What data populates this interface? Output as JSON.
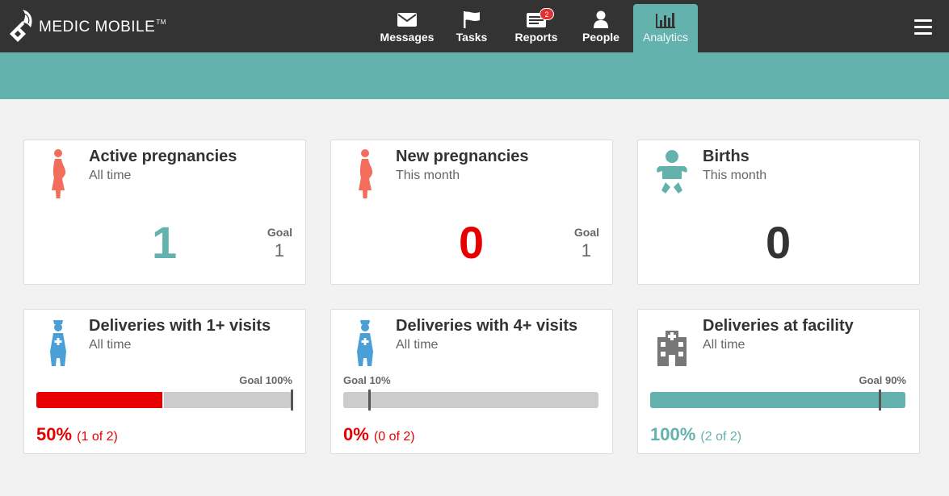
{
  "app": {
    "brand": "MEDIC MOBILE",
    "trademark": "TM"
  },
  "nav": {
    "tabs": [
      {
        "label": "Messages",
        "icon": "envelope-icon",
        "active": false
      },
      {
        "label": "Tasks",
        "icon": "flag-icon",
        "active": false
      },
      {
        "label": "Reports",
        "icon": "reports-icon",
        "active": false,
        "badge": "2"
      },
      {
        "label": "People",
        "icon": "person-icon",
        "active": false
      },
      {
        "label": "Analytics",
        "icon": "bar-chart-icon",
        "active": true
      }
    ],
    "menu_icon": "hamburger-icon"
  },
  "colors": {
    "header": "#333333",
    "accent": "#63b2ae",
    "negative": "#e60000",
    "track": "#cccccc"
  },
  "widgets": [
    {
      "title": "Active pregnancies",
      "subtitle": "All time",
      "icon": "pregnant-woman-icon",
      "value": "1",
      "value_color": "#63b2ae",
      "goal_label": "Goal",
      "goal_value": "1"
    },
    {
      "title": "New pregnancies",
      "subtitle": "This month",
      "icon": "pregnant-woman-icon",
      "value": "0",
      "value_color": "#e60000",
      "goal_label": "Goal",
      "goal_value": "1"
    },
    {
      "title": "Births",
      "subtitle": "This month",
      "icon": "baby-icon",
      "value": "0",
      "value_color": "#333333"
    },
    {
      "title": "Deliveries with 1+ visits",
      "subtitle": "All time",
      "icon": "nurse-icon",
      "goal_label": "Goal 100%",
      "goal_percent": 100,
      "progress_percent": 50,
      "percent_text": "50%",
      "detail_text": "(1 of 2)",
      "color": "#e60000"
    },
    {
      "title": "Deliveries with 4+ visits",
      "subtitle": "All time",
      "icon": "nurse-icon",
      "goal_label": "Goal 10%",
      "goal_percent": 10,
      "progress_percent": 0,
      "percent_text": "0%",
      "detail_text": "(0 of 2)",
      "color": "#e60000"
    },
    {
      "title": "Deliveries at facility",
      "subtitle": "All time",
      "icon": "hospital-icon",
      "goal_label": "Goal 90%",
      "goal_percent": 90,
      "progress_percent": 100,
      "percent_text": "100%",
      "detail_text": "(2 of 2)",
      "color": "#63b2ae"
    }
  ]
}
